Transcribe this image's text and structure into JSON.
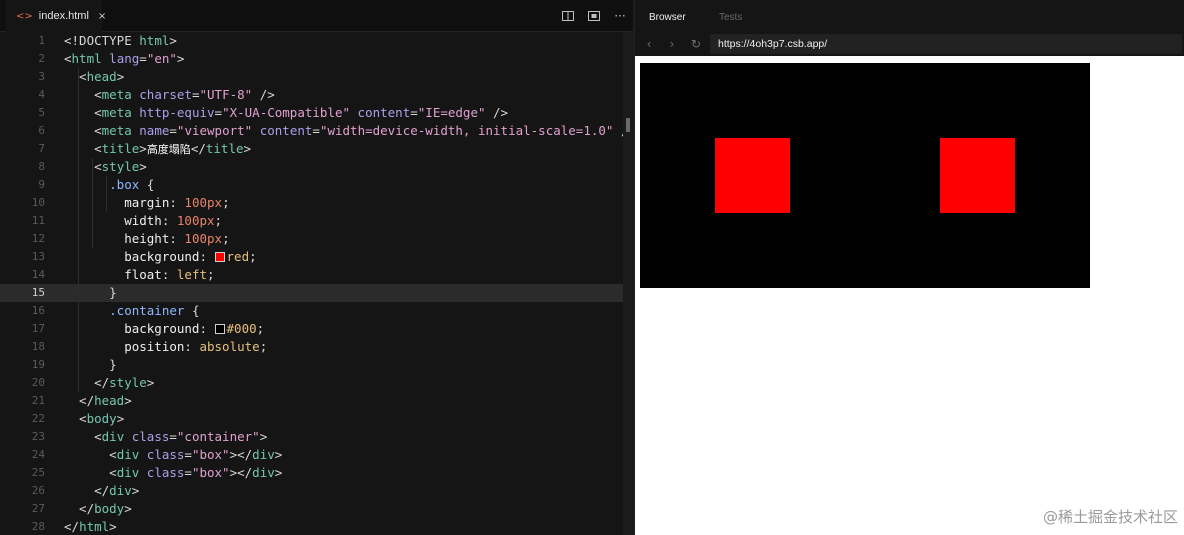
{
  "editor": {
    "tab": {
      "icon": "html-file-icon",
      "label": "index.html",
      "close": "×"
    },
    "actions": [
      "split-editor-icon",
      "preview-icon",
      "more-icon"
    ],
    "current_line": 15,
    "line_numbers": [
      "1",
      "2",
      "3",
      "4",
      "5",
      "6",
      "7",
      "8",
      "9",
      "10",
      "11",
      "12",
      "13",
      "14",
      "15",
      "16",
      "17",
      "18",
      "19",
      "20",
      "21",
      "22",
      "23",
      "24",
      "25",
      "26",
      "27",
      "28"
    ]
  },
  "code_lines": [
    [
      [
        "t-pun",
        "<!DOCTYPE "
      ],
      [
        "t-tag",
        "html"
      ],
      [
        "t-pun",
        ">"
      ]
    ],
    [
      [
        "t-pun",
        "<"
      ],
      [
        "t-tag",
        "html"
      ],
      [
        "t-attr",
        " lang"
      ],
      [
        "t-pun",
        "="
      ],
      [
        "t-str",
        "\"en\""
      ],
      [
        "t-pun",
        ">"
      ]
    ],
    [
      [
        "t-pun",
        "  <"
      ],
      [
        "t-tag",
        "head"
      ],
      [
        "t-pun",
        ">"
      ]
    ],
    [
      [
        "t-pun",
        "    <"
      ],
      [
        "t-tag",
        "meta"
      ],
      [
        "t-attr",
        " charset"
      ],
      [
        "t-pun",
        "="
      ],
      [
        "t-str",
        "\"UTF-8\""
      ],
      [
        "t-pun",
        " />"
      ]
    ],
    [
      [
        "t-pun",
        "    <"
      ],
      [
        "t-tag",
        "meta"
      ],
      [
        "t-attr",
        " http-equiv"
      ],
      [
        "t-pun",
        "="
      ],
      [
        "t-str",
        "\"X-UA-Compatible\""
      ],
      [
        "t-attr",
        " content"
      ],
      [
        "t-pun",
        "="
      ],
      [
        "t-str",
        "\"IE=edge\""
      ],
      [
        "t-pun",
        " />"
      ]
    ],
    [
      [
        "t-pun",
        "    <"
      ],
      [
        "t-tag",
        "meta"
      ],
      [
        "t-attr",
        " name"
      ],
      [
        "t-pun",
        "="
      ],
      [
        "t-str",
        "\"viewport\""
      ],
      [
        "t-attr",
        " content"
      ],
      [
        "t-pun",
        "="
      ],
      [
        "t-str",
        "\"width=device-width, initial-scale=1.0\""
      ],
      [
        "t-pun",
        " />"
      ]
    ],
    [
      [
        "t-pun",
        "    <"
      ],
      [
        "t-tag",
        "title"
      ],
      [
        "t-pun",
        ">"
      ],
      [
        "t-cn",
        "高度塌陷"
      ],
      [
        "t-pun",
        "</"
      ],
      [
        "t-tag",
        "title"
      ],
      [
        "t-pun",
        ">"
      ]
    ],
    [
      [
        "t-pun",
        "    <"
      ],
      [
        "t-tag",
        "style"
      ],
      [
        "t-pun",
        ">"
      ]
    ],
    [
      [
        "t-sel",
        "      .box"
      ],
      [
        "t-pun",
        " {"
      ]
    ],
    [
      [
        "t-prop",
        "        margin"
      ],
      [
        "t-pun",
        ": "
      ],
      [
        "t-num",
        "100px"
      ],
      [
        "t-pun",
        ";"
      ]
    ],
    [
      [
        "t-prop",
        "        width"
      ],
      [
        "t-pun",
        ": "
      ],
      [
        "t-num",
        "100px"
      ],
      [
        "t-pun",
        ";"
      ]
    ],
    [
      [
        "t-prop",
        "        height"
      ],
      [
        "t-pun",
        ": "
      ],
      [
        "t-num",
        "100px"
      ],
      [
        "t-pun",
        ";"
      ]
    ],
    [
      [
        "t-prop",
        "        background"
      ],
      [
        "t-pun",
        ": "
      ],
      [
        "swatch",
        "#ff0000"
      ],
      [
        "t-kw",
        "red"
      ],
      [
        "t-pun",
        ";"
      ]
    ],
    [
      [
        "t-prop",
        "        float"
      ],
      [
        "t-pun",
        ": "
      ],
      [
        "t-kw",
        "left"
      ],
      [
        "t-pun",
        ";"
      ]
    ],
    [
      [
        "t-pun",
        "      }"
      ]
    ],
    [
      [
        "t-sel",
        "      .container"
      ],
      [
        "t-pun",
        " {"
      ]
    ],
    [
      [
        "t-prop",
        "        background"
      ],
      [
        "t-pun",
        ": "
      ],
      [
        "swatch",
        "#000000"
      ],
      [
        "t-kw",
        "#000"
      ],
      [
        "t-pun",
        ";"
      ]
    ],
    [
      [
        "t-prop",
        "        position"
      ],
      [
        "t-pun",
        ": "
      ],
      [
        "t-kw",
        "absolute"
      ],
      [
        "t-pun",
        ";"
      ]
    ],
    [
      [
        "t-pun",
        "      }"
      ]
    ],
    [
      [
        "t-pun",
        "    </"
      ],
      [
        "t-tag",
        "style"
      ],
      [
        "t-pun",
        ">"
      ]
    ],
    [
      [
        "t-pun",
        "  </"
      ],
      [
        "t-tag",
        "head"
      ],
      [
        "t-pun",
        ">"
      ]
    ],
    [
      [
        "t-pun",
        "  <"
      ],
      [
        "t-tag",
        "body"
      ],
      [
        "t-pun",
        ">"
      ]
    ],
    [
      [
        "t-pun",
        "    <"
      ],
      [
        "t-tag",
        "div"
      ],
      [
        "t-attr",
        " class"
      ],
      [
        "t-pun",
        "="
      ],
      [
        "t-str",
        "\"container\""
      ],
      [
        "t-pun",
        ">"
      ]
    ],
    [
      [
        "t-pun",
        "      <"
      ],
      [
        "t-tag",
        "div"
      ],
      [
        "t-attr",
        " class"
      ],
      [
        "t-pun",
        "="
      ],
      [
        "t-str",
        "\"box\""
      ],
      [
        "t-pun",
        "></"
      ],
      [
        "t-tag",
        "div"
      ],
      [
        "t-pun",
        ">"
      ]
    ],
    [
      [
        "t-pun",
        "      <"
      ],
      [
        "t-tag",
        "div"
      ],
      [
        "t-attr",
        " class"
      ],
      [
        "t-pun",
        "="
      ],
      [
        "t-str",
        "\"box\""
      ],
      [
        "t-pun",
        "></"
      ],
      [
        "t-tag",
        "div"
      ],
      [
        "t-pun",
        ">"
      ]
    ],
    [
      [
        "t-pun",
        "    </"
      ],
      [
        "t-tag",
        "div"
      ],
      [
        "t-pun",
        ">"
      ]
    ],
    [
      [
        "t-pun",
        "  </"
      ],
      [
        "t-tag",
        "body"
      ],
      [
        "t-pun",
        ">"
      ]
    ],
    [
      [
        "t-pun",
        "</"
      ],
      [
        "t-tag",
        "html"
      ],
      [
        "t-pun",
        ">"
      ]
    ]
  ],
  "browser": {
    "tabs": {
      "browser": "Browser",
      "tests": "Tests"
    },
    "nav": {
      "back": "‹",
      "forward": "›",
      "reload": "↻"
    },
    "url": "https://4oh3p7.csb.app/",
    "preview": {
      "container_color": "#000000",
      "box_color": "#ff0000"
    }
  },
  "watermark": "@稀土掘金技术社区"
}
